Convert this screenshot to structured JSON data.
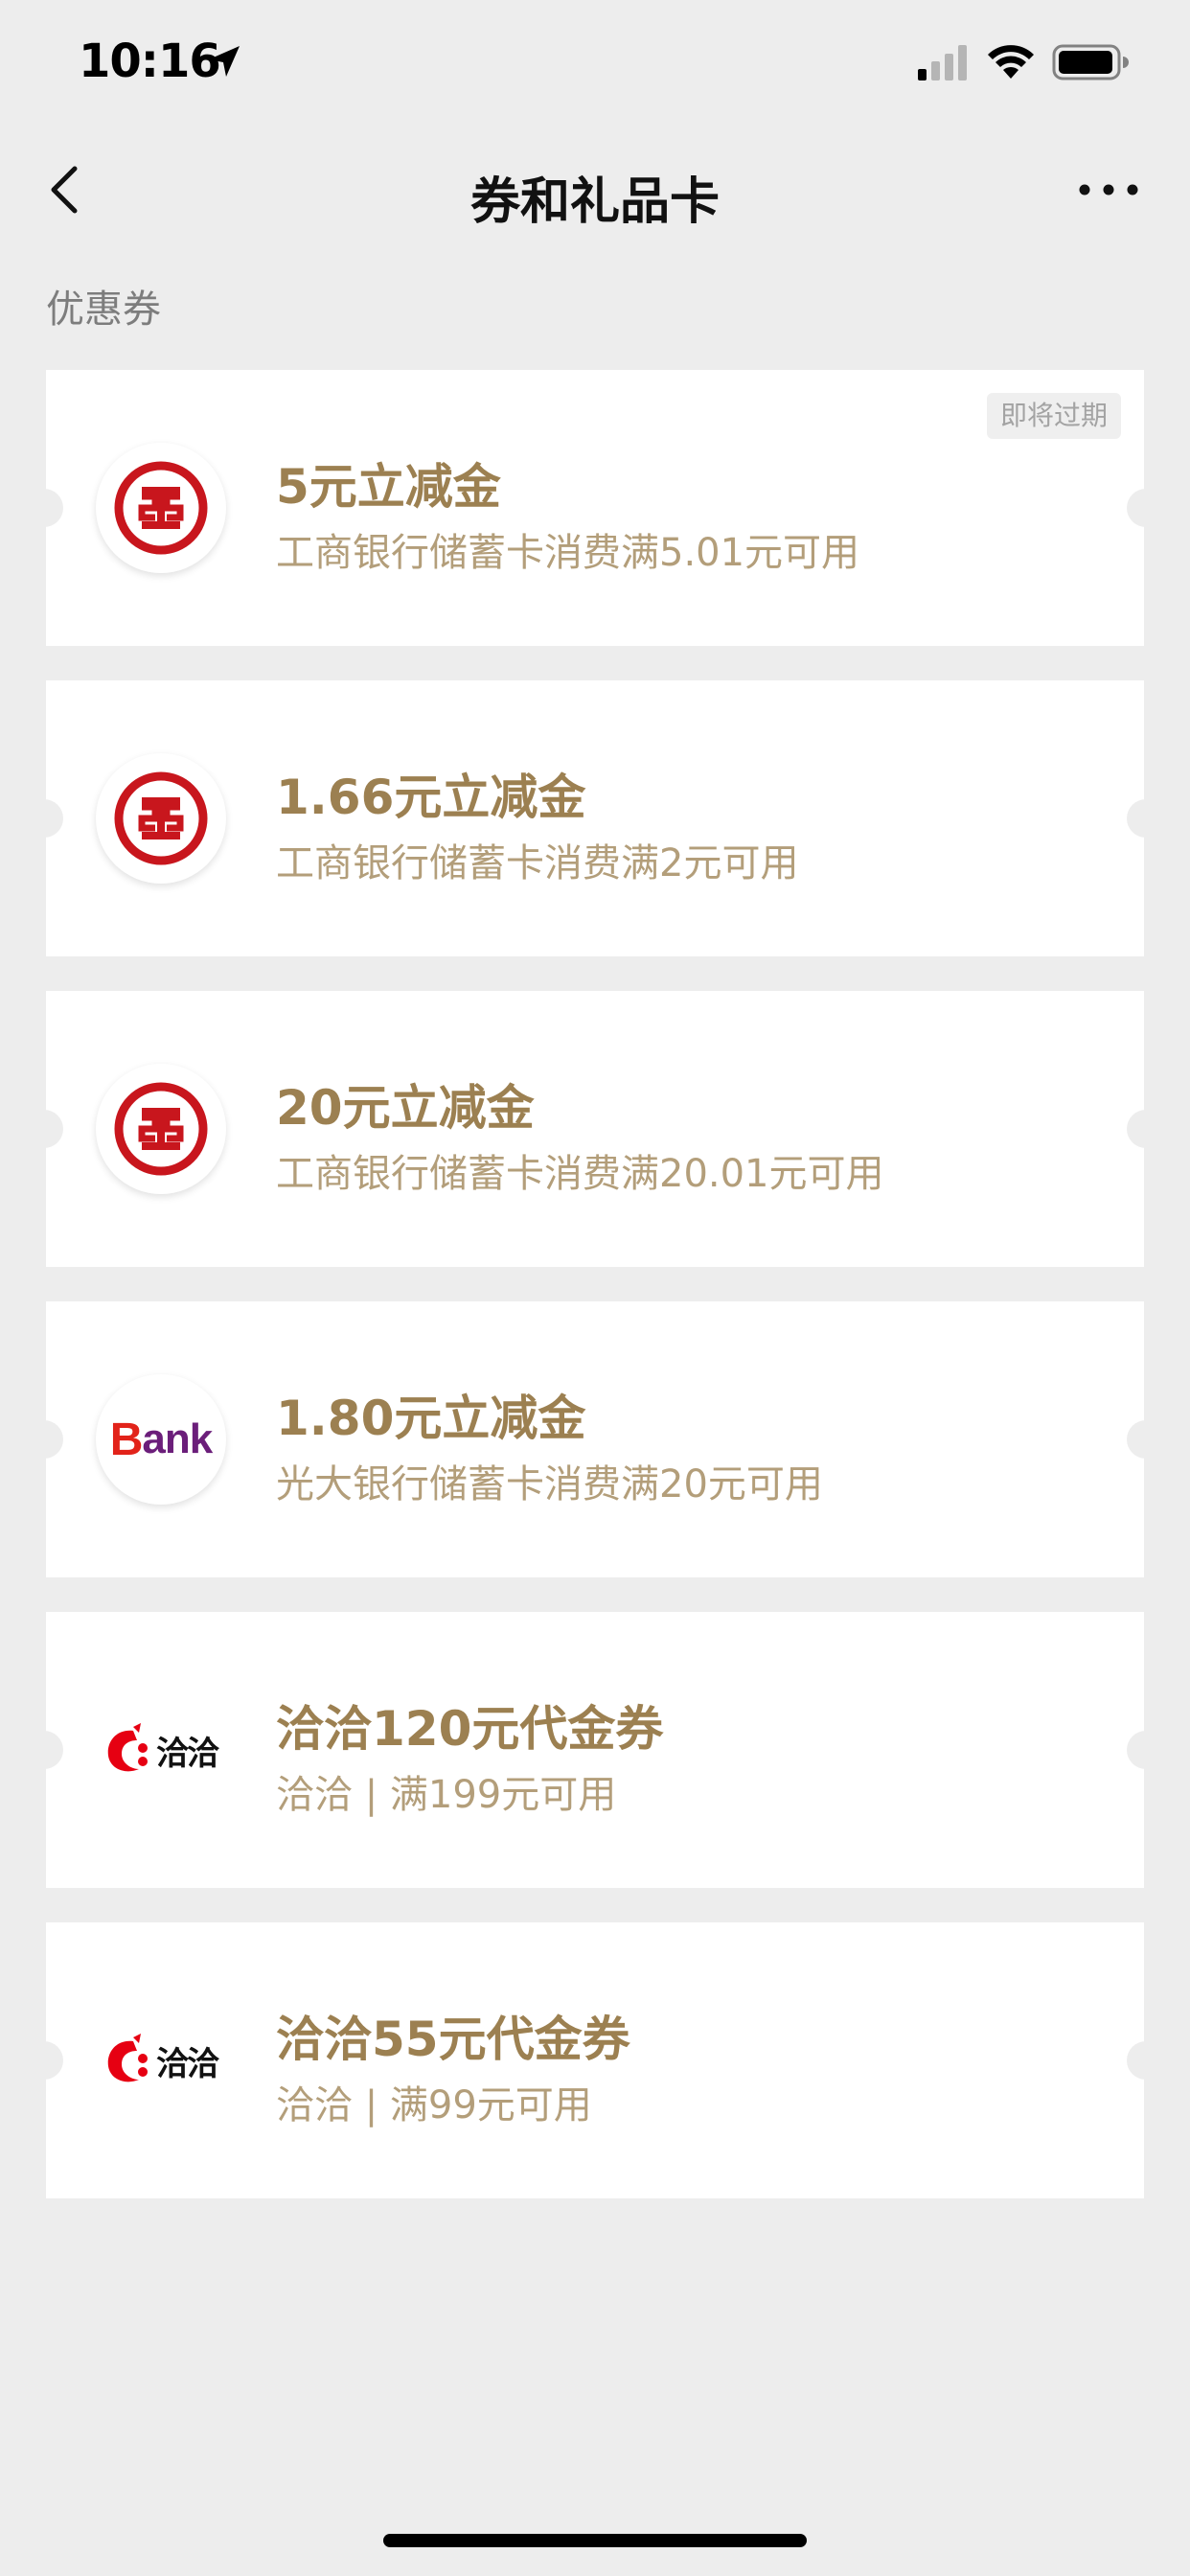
{
  "status_bar": {
    "time": "10:16"
  },
  "nav": {
    "title": "券和礼品卡"
  },
  "section": {
    "title": "优惠券"
  },
  "coupons": [
    {
      "title": "5元立减金",
      "desc": "工商银行储蓄卡消费满5.01元可用",
      "logo": "icbc-logo",
      "badge": "即将过期"
    },
    {
      "title": "1.66元立减金",
      "desc": "工商银行储蓄卡消费满2元可用",
      "logo": "icbc-logo"
    },
    {
      "title": "20元立减金",
      "desc": "工商银行储蓄卡消费满20.01元可用",
      "logo": "icbc-logo"
    },
    {
      "title": "1.80元立减金",
      "desc": "光大银行储蓄卡消费满20元可用",
      "logo": "ceb-logo",
      "logo_text": "ank",
      "logo_initial": "B"
    },
    {
      "title": "洽洽120元代金券",
      "desc": "洽洽 | 满199元可用",
      "logo": "qiaqia-logo",
      "logo_text": "洽洽"
    },
    {
      "title": "洽洽55元代金券",
      "desc": "洽洽 | 满99元可用",
      "logo": "qiaqia-logo",
      "logo_text": "洽洽"
    }
  ],
  "colors": {
    "accent": "#9c8051",
    "sub": "#b39e7a",
    "background": "#ededed",
    "icbc_red": "#c8161d",
    "ceb_purple": "#6b1e7a"
  }
}
